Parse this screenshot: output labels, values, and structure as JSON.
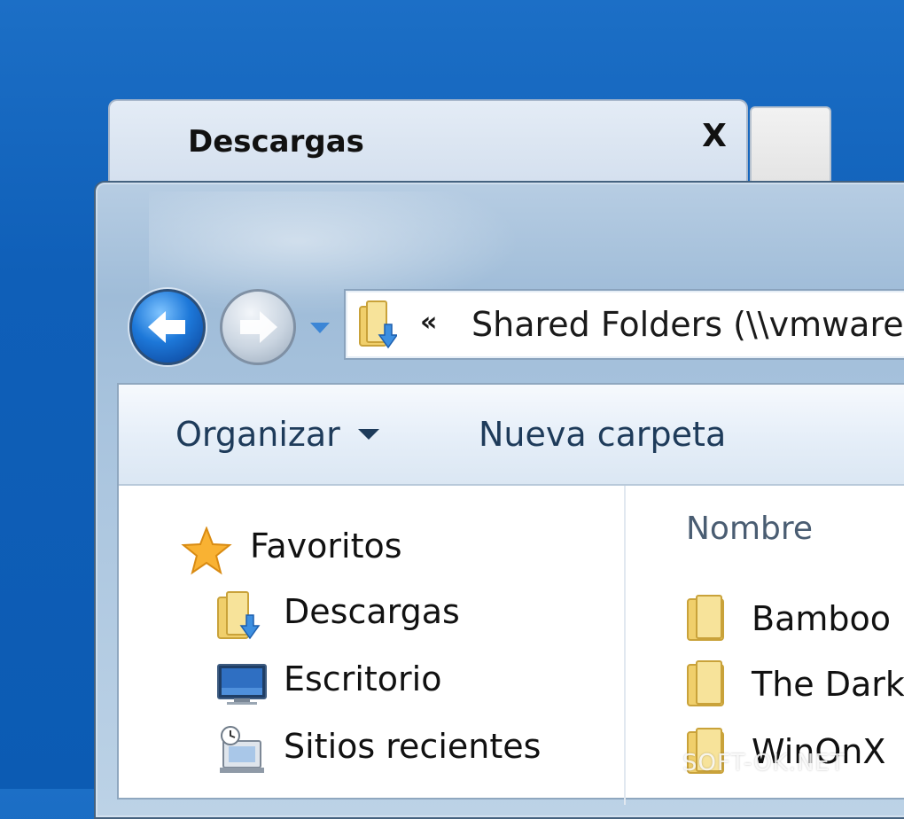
{
  "tab": {
    "title": "Descargas",
    "close": "X"
  },
  "address_bar": {
    "overflow_chevron": "«",
    "path": "Shared Folders (\\\\vmware"
  },
  "toolbar": {
    "organize_label": "Organizar",
    "new_folder_label": "Nueva carpeta"
  },
  "nav_pane": {
    "items": [
      {
        "label": "Favoritos",
        "icon": "star-icon"
      },
      {
        "label": "Descargas",
        "icon": "downloads-folder-icon"
      },
      {
        "label": "Escritorio",
        "icon": "desktop-icon"
      },
      {
        "label": "Sitios recientes",
        "icon": "recent-places-icon"
      }
    ]
  },
  "file_list": {
    "column_name": "Nombre",
    "files": [
      {
        "name": "Bamboo"
      },
      {
        "name": "The Dark"
      },
      {
        "name": "WinOnX"
      }
    ]
  },
  "watermark": "SOFT-OK.NET",
  "colors": {
    "desktop": "#0c5bb3",
    "back_button": "#1d78d9",
    "toolbar_text": "#1e3b5a"
  }
}
